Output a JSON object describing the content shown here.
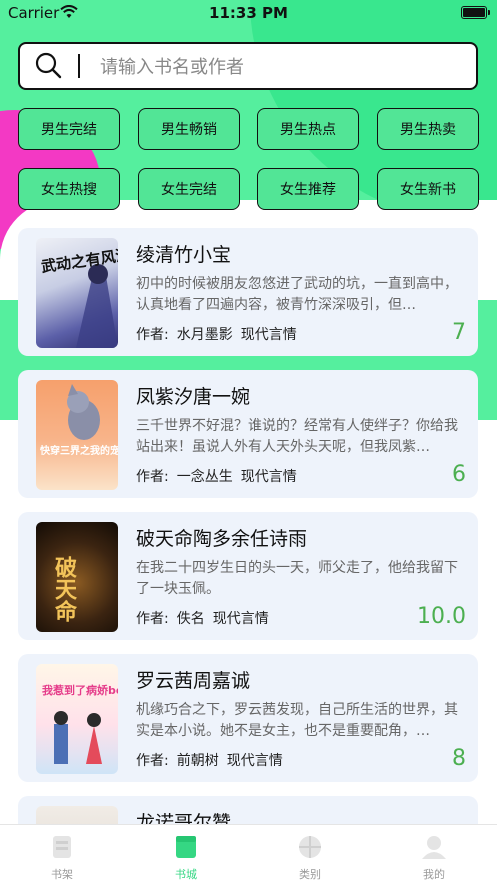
{
  "status": {
    "carrier": "Carrier",
    "time": "11:33 PM"
  },
  "search": {
    "placeholder": "请输入书名或作者"
  },
  "categories": [
    "男生完结",
    "男生畅销",
    "男生热点",
    "男生热卖",
    "女生热搜",
    "女生完结",
    "女生推荐",
    "女生新书"
  ],
  "books": [
    {
      "title": "绫清竹小宝",
      "desc": "初中的时候被朋友忽悠进了武动的坑，一直到高中，认真地看了四遍内容，被青竹深深吸引，但…",
      "author_prefix": "作者:",
      "author": "水月墨影",
      "genre": "现代言情",
      "score": "7",
      "cover_text": "武动之有风清竹"
    },
    {
      "title": "凤紫汐唐一婉",
      "desc": "三千世界不好混？谁说的？经常有人使绊子？你给我站出来！虽说人外有人天外头天呢，但我凤紫…",
      "author_prefix": "作者:",
      "author": "一念丛生",
      "genre": "现代言情",
      "score": "6",
      "cover_text": "快穿三界之我的宠物是闽罗大佬"
    },
    {
      "title": "破天命陶多余任诗雨",
      "desc": "在我二十四岁生日的头一天，师父走了，他给我留下了一块玉佩。",
      "author_prefix": "作者:",
      "author": "佚名",
      "genre": "现代言情",
      "score": "10.0",
      "cover_text": "破天命"
    },
    {
      "title": "罗云茜周嘉诚",
      "desc": "机缘巧合之下，罗云茜发现，自己所生活的世界，其实是本小说。她不是女主，也不是重要配角，…",
      "author_prefix": "作者:",
      "author": "前朝树",
      "genre": "现代言情",
      "score": "8",
      "cover_text": "我惹到了病娇boss"
    },
    {
      "title": "龙诺哥尔赞",
      "desc": "",
      "author_prefix": "",
      "author": "",
      "genre": "",
      "score": "",
      "cover_text": ""
    }
  ],
  "tabs": [
    {
      "label": "书架",
      "icon": "bookshelf-icon"
    },
    {
      "label": "书城",
      "icon": "bookstore-icon"
    },
    {
      "label": "类别",
      "icon": "category-icon"
    },
    {
      "label": "我的",
      "icon": "profile-icon"
    }
  ],
  "colors": {
    "accent": "#35d783",
    "hero": "#55ef9e",
    "pink": "#f339c4",
    "score": "#4caf50"
  }
}
